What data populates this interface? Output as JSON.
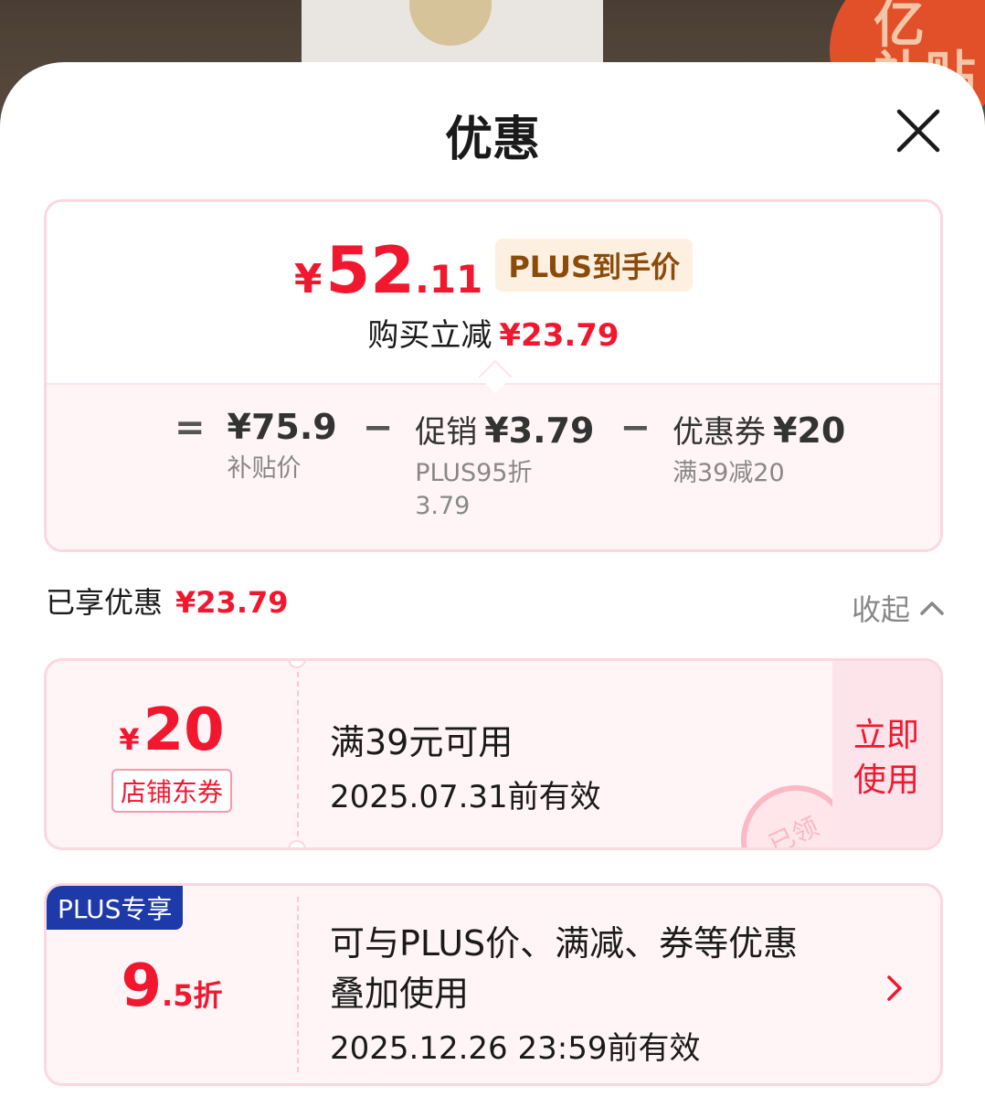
{
  "backdrop": {
    "badge_line1": "亿",
    "badge_line2": "补贴"
  },
  "sheet": {
    "title": "优惠"
  },
  "summary": {
    "price_symbol": "¥",
    "price_int": "52",
    "price_dec": ".11",
    "price_tag": "PLUS到手价",
    "saving_label": "购买立减",
    "saving_value": "¥23.79",
    "equals": "=",
    "minus": "−",
    "base_price": "¥75.9",
    "base_label": "补贴价",
    "promo_label": "促销",
    "promo_value": "¥3.79",
    "promo_sub1": "PLUS95折",
    "promo_sub2": "3.79",
    "coupon_label": "优惠券",
    "coupon_value": "¥20",
    "coupon_sub": "满39减20"
  },
  "enjoyed": {
    "label": "已享优惠",
    "value": "¥23.79",
    "collapse_label": "收起"
  },
  "coupons": [
    {
      "symbol": "¥",
      "amount": "20",
      "tag": "店铺东券",
      "line1": "满39元可用",
      "line2": "2025.07.31前有效",
      "button_line1": "立即",
      "button_line2": "使用",
      "stamp": "已领"
    },
    {
      "badge": "PLUS专享",
      "amount_int": "9",
      "amount_dec": ".5折",
      "line1a": "可与PLUS价、满减、券等优惠",
      "line1b": "叠加使用",
      "line2": "2025.12.26 23:59前有效"
    }
  ],
  "colors": {
    "accent": "#f0172f",
    "plus_badge": "#1d3aa8",
    "tag_bg": "#fdf0e0"
  }
}
